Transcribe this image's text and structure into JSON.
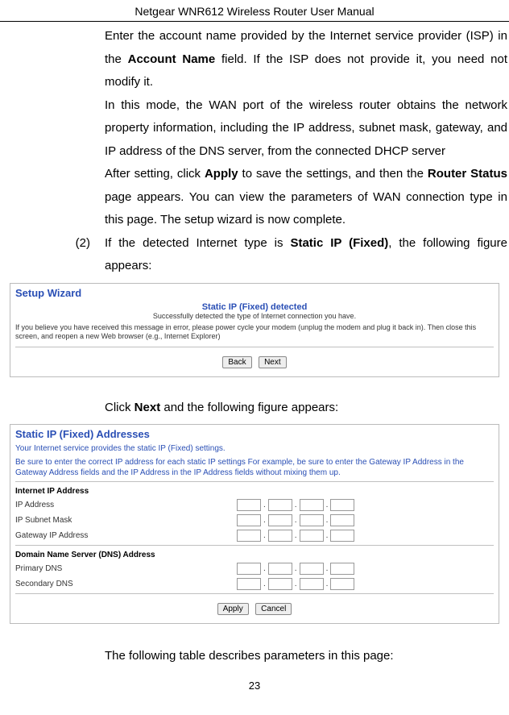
{
  "header": {
    "title": "Netgear WNR612 Wireless Router User Manual"
  },
  "para1_a": "Enter the account name provided by the Internet service provider (ISP) in the ",
  "para1_bold1": "Account Name",
  "para1_b": " field. If the ISP does not provide it, you need not modify it.",
  "para2": "In this mode, the WAN port of the wireless router obtains the network property information, including the IP address, subnet mask, gateway, and IP address of the DNS server, from the connected DHCP server",
  "para3_a": "After setting, click ",
  "para3_bold1": "Apply",
  "para3_b": " to save the settings, and then the ",
  "para3_bold2": "Router Status",
  "para3_c": " page appears. You can view the parameters of WAN connection type in this page. The setup wizard is now complete.",
  "item2_num": "(2)",
  "item2_a": "If the detected Internet type is ",
  "item2_bold": "Static IP (Fixed)",
  "item2_b": ", the following figure appears:",
  "wizard": {
    "title": "Setup Wizard",
    "subtitle": "Static IP (Fixed) detected",
    "subtitle2": "Successfully detected the type of Internet connection you have.",
    "instructions": "If you believe you have received this message in error, please power cycle your modem (unplug the modem and plug it back in). Then close this screen, and reopen a new Web browser (e.g., Internet Explorer)",
    "back": "Back",
    "next": "Next"
  },
  "click_next_a": "Click ",
  "click_next_bold": "Next",
  "click_next_b": " and the following figure appears:",
  "fixed": {
    "title": "Static IP (Fixed) Addresses",
    "para1": "Your Internet service provides the static IP (Fixed) settings.",
    "para2": "Be sure to enter the correct IP address for each static IP settings For example, be sure to enter the Gateway IP Address in the Gateway Address fields and the IP Address in the IP Address fields without mixing them up.",
    "section1": "Internet IP Address",
    "ip_address": "IP Address",
    "subnet": "IP Subnet Mask",
    "gateway": "Gateway IP Address",
    "section2": "Domain Name Server (DNS) Address",
    "primary": "Primary DNS",
    "secondary": "Secondary DNS",
    "apply": "Apply",
    "cancel": "Cancel"
  },
  "table_intro": "The following table describes parameters in this page:",
  "page_number": "23"
}
